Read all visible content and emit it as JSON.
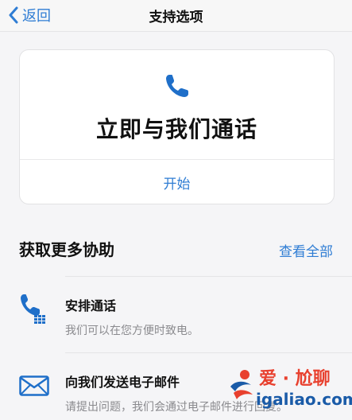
{
  "nav": {
    "back_label": "返回",
    "title": "支持选项"
  },
  "call_card": {
    "headline": "立即与我们通话",
    "start_label": "开始"
  },
  "more_help": {
    "title": "获取更多协助",
    "see_all_label": "查看全部",
    "items": [
      {
        "icon": "phone-schedule-icon",
        "title": "安排通话",
        "description": "我们可以在您方便时致电。"
      },
      {
        "icon": "envelope-icon",
        "title": "向我们发送电子邮件",
        "description": "请提出问题，我们会通过电子邮件进行回复。"
      }
    ]
  },
  "watermark": {
    "line1": "爱 · 尬聊",
    "line2": "igaliao.com"
  },
  "colors": {
    "accent": "#2f7dd4",
    "secondary_text": "#8a8a8e",
    "background": "#f5f5f7"
  }
}
